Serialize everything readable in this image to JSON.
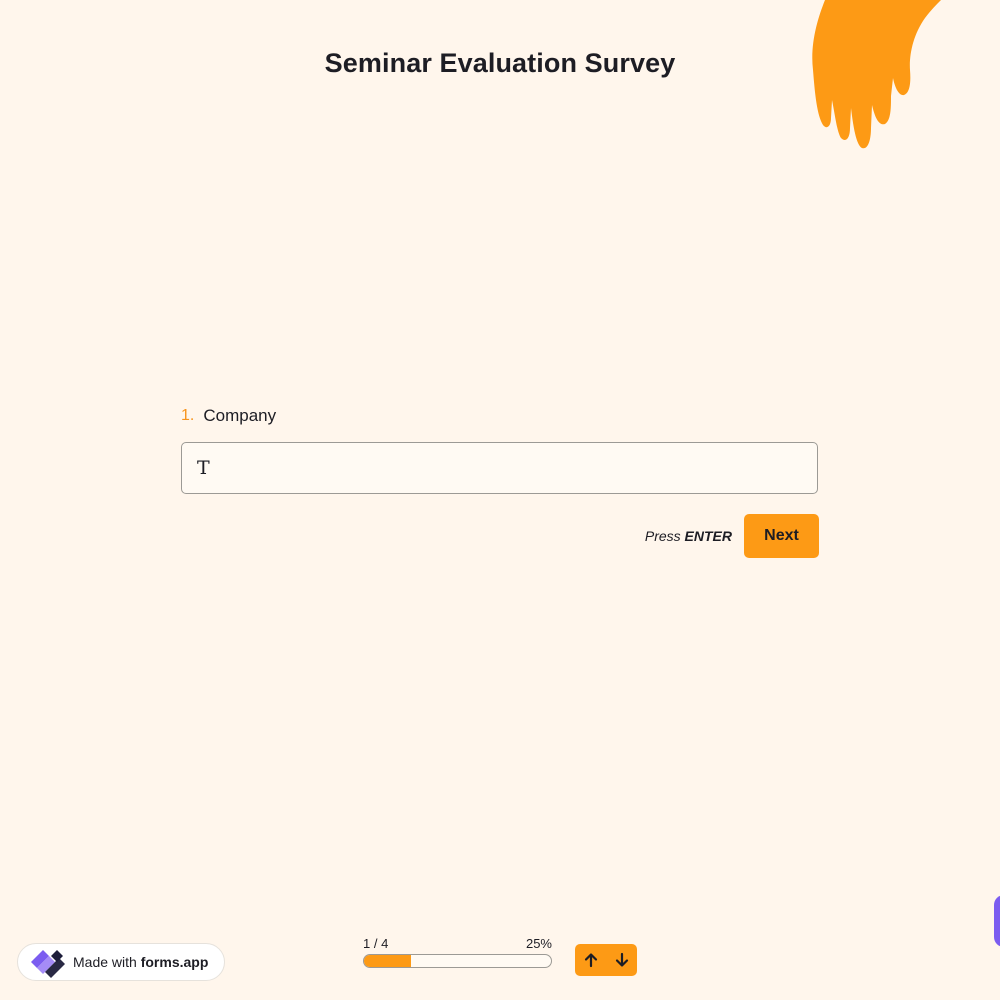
{
  "survey": {
    "title": "Seminar Evaluation Survey"
  },
  "question": {
    "number": "1.",
    "label": "Company",
    "input_value": "T",
    "input_placeholder": ""
  },
  "actions": {
    "press_prefix": "Press",
    "press_key": "ENTER",
    "next_label": "Next"
  },
  "footer": {
    "badge_prefix": "Made with",
    "badge_brand": "forms.app",
    "progress_step": "1 / 4",
    "progress_percent": "25%",
    "progress_fraction": 0.25
  },
  "icons": {
    "nav_up": "arrow-up-icon",
    "nav_down": "arrow-down-icon",
    "logo": "forms-app-logo-icon"
  },
  "colors": {
    "background": "#fff6ec",
    "accent": "#fd9a15",
    "question_number": "#f7941d",
    "logo_dark": "#1d1d3a",
    "logo_purple": "#7b5cf0"
  }
}
